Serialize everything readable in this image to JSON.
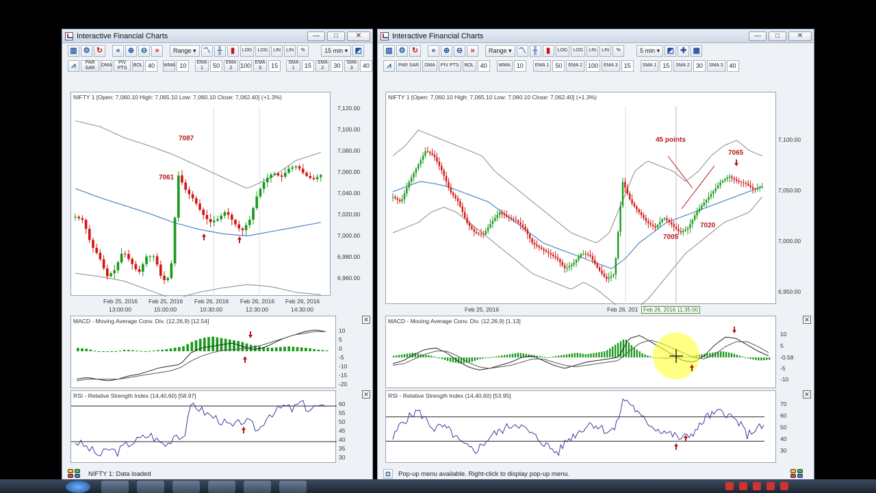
{
  "window_title": "Interactive Financial Charts",
  "window_buttons": {
    "minimize": "—",
    "maximize": "□",
    "close": "✕"
  },
  "toolbar1_left": {
    "range": "Range",
    "interval": "15 min"
  },
  "toolbar1_right": {
    "range": "Range",
    "interval": "5 min"
  },
  "toolbar_labels": {
    "log": "LOG",
    "lin": "LIN",
    "pct": "%"
  },
  "toolbar2": {
    "par_sar": "PAR SAR",
    "dma": "DMA",
    "piv_pts": "PIV PTS",
    "bol": "BOL",
    "bol_val": "40",
    "wma": "WMA",
    "wma_val": "10",
    "ema1": "EMA 1",
    "ema1_val": "50",
    "ema2": "EMA 2",
    "ema2_val": "100",
    "ema3": "EMA 3",
    "ema3_val": "15",
    "sma1": "SMA 1",
    "sma1_val": "15",
    "sma2": "SMA 2",
    "sma2_val": "30",
    "sma3": "SMA 3",
    "sma3_val": "40"
  },
  "left": {
    "price_label": "NIFTY 1 [Open: 7,060.10  High: 7,065.10  Low: 7,060.10  Close: 7,062.40] (+1.3%)",
    "price_yticks": [
      "7,120.00",
      "7,100.00",
      "7,080.00",
      "7,060.00",
      "7,040.00",
      "7,020.00",
      "7,000.00",
      "6,980.00",
      "6,960.00"
    ],
    "xticks_date": [
      "Feb 25, 2016",
      "Feb 25, 2016",
      "Feb 26, 2016",
      "Feb 26, 2016",
      "Feb 26, 2016"
    ],
    "xticks_time": [
      "13:00:00",
      "15:00:00",
      "10:30:00",
      "12:30:00",
      "14:30:00"
    ],
    "annotations": {
      "a7087": "7087",
      "a7061": "7061"
    },
    "macd_label": "MACD - Moving Average Conv. Div. (12,26,9) [12.54]",
    "macd_yticks": [
      "10",
      "5",
      "0",
      "-5",
      "-10",
      "-15",
      "-20"
    ],
    "rsi_label": "RSI - Relative Strength Index (14,40,60) [58.97]",
    "rsi_yticks": [
      "60",
      "55",
      "50",
      "45",
      "40",
      "35",
      "30"
    ],
    "status": "NIFTY 1: Data loaded"
  },
  "right": {
    "price_label": "NIFTY 1 [Open: 7,060.10  High: 7,065.10  Low: 7,060.10  Close: 7,062.40] (+1.3%)",
    "price_yticks": [
      "7,100.00",
      "7,050.00",
      "7,000.00",
      "6,950.00"
    ],
    "xticks_date": [
      "Feb 25, 2016",
      "Feb 26, 201"
    ],
    "crosshair_label": "Feb 26, 2016 11:35:00",
    "annotations": {
      "a45": "45 points",
      "a7065": "7065",
      "a7020": "7020",
      "a7005": "7005"
    },
    "macd_label": "MACD - Moving Average Conv. Div. (12,26,9) [1.13]",
    "macd_yticks": [
      "10",
      "5",
      "-0.58",
      "-5",
      "-10"
    ],
    "rsi_label": "RSI - Relative Strength Index (14,40,60) [53.95]",
    "rsi_yticks": [
      "70",
      "60",
      "50",
      "40",
      "30"
    ],
    "status": "Pop-up menu available. Right-click to display pop-up menu."
  },
  "colors": {
    "up": "#1a9a1a",
    "down": "#d41414",
    "band": "#888888",
    "ma": "#4a86c8",
    "macd": "#222222",
    "rsi": "#3a3aa0",
    "annotation": "#b51818"
  }
}
